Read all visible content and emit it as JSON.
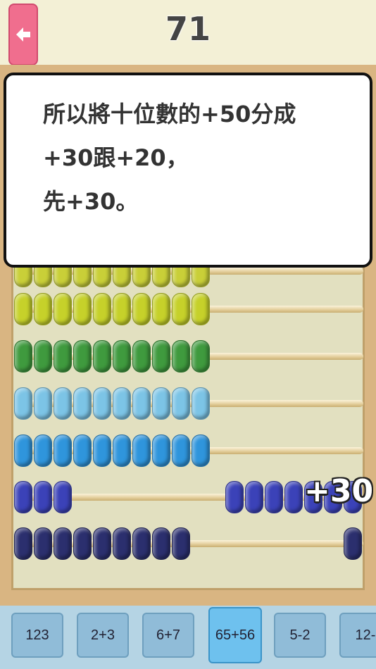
{
  "header": {
    "score": "71"
  },
  "dialog": {
    "lines": [
      "所以將十位數的+50分成",
      "+30跟+20，",
      "先+30。"
    ]
  },
  "abacus": {
    "rows": [
      {
        "color": "#c9cf38",
        "left_beads": 10,
        "right_beads": 0
      },
      {
        "color": "#c6d12a",
        "left_beads": 10,
        "right_beads": 0
      },
      {
        "color": "#3f9a3e",
        "left_beads": 10,
        "right_beads": 0
      },
      {
        "color": "#7cc4e6",
        "left_beads": 10,
        "right_beads": 0
      },
      {
        "color": "#2f95dc",
        "left_beads": 10,
        "right_beads": 0
      },
      {
        "color": "#3b42b8",
        "left_beads": 3,
        "right_beads": 7
      },
      {
        "color": "#2b2f6e",
        "left_beads": 9,
        "right_beads": 1
      }
    ],
    "overlay": "+30"
  },
  "tabs": [
    {
      "label": "123",
      "active": false
    },
    {
      "label": "2+3",
      "active": false
    },
    {
      "label": "6+7",
      "active": false
    },
    {
      "label": "65+56",
      "active": true
    },
    {
      "label": "5-2",
      "active": false
    },
    {
      "label": "12-",
      "active": false
    }
  ]
}
